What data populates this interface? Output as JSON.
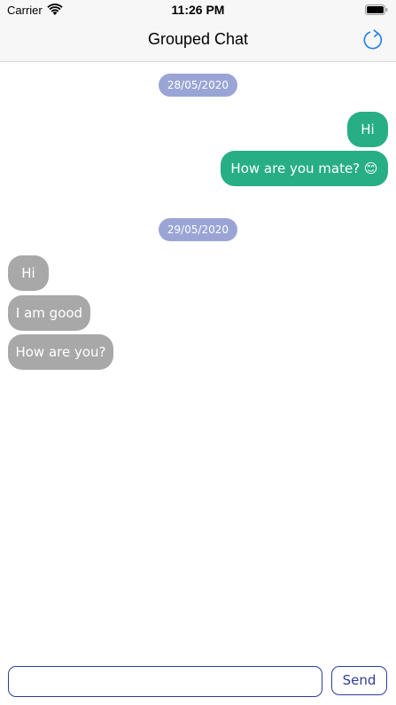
{
  "status_bar": {
    "carrier": "Carrier",
    "time": "11:26 PM",
    "icons": [
      "wifi-icon",
      "battery-icon"
    ]
  },
  "nav": {
    "title": "Grouped Chat",
    "refresh_icon": "refresh-icon"
  },
  "groups": [
    {
      "date": "28/05/2020",
      "messages": [
        {
          "text": "Hi",
          "from": "me"
        },
        {
          "text": "How are you mate? 😊",
          "from": "me"
        }
      ]
    },
    {
      "date": "29/05/2020",
      "messages": [
        {
          "text": "Hi",
          "from": "other"
        },
        {
          "text": "I am good",
          "from": "other"
        },
        {
          "text": "How are you?",
          "from": "other"
        }
      ]
    }
  ],
  "input": {
    "value": "",
    "placeholder": "",
    "send_label": "Send"
  },
  "colors": {
    "sent_bubble": "#27ae85",
    "received_bubble": "#a8a8a8",
    "date_pill": "#9aa5d6",
    "accent": "#2e3b9e"
  }
}
